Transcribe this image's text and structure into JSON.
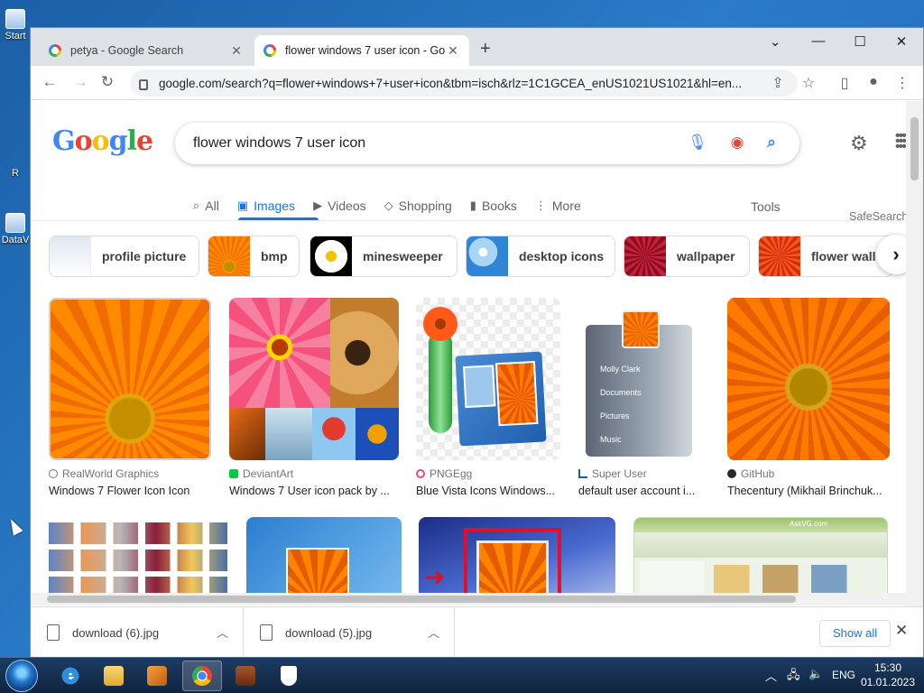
{
  "desktop": {
    "icons": [
      {
        "label": "Start"
      },
      {
        "label": "R"
      },
      {
        "label": "DataV"
      }
    ]
  },
  "browser": {
    "tabs": [
      {
        "title": "petya - Google Search",
        "active": false
      },
      {
        "title": "flower windows 7 user icon - Go",
        "active": true
      }
    ],
    "url": "google.com/search?q=flower+windows+7+user+icon&tbm=isch&rlz=1C1GCEA_enUS1021US1021&hl=en..."
  },
  "search": {
    "logo_letters": [
      "G",
      "o",
      "o",
      "g",
      "l",
      "e"
    ],
    "query": "flower windows 7 user icon",
    "nav_tabs": [
      {
        "label": "All",
        "icon": "search-icon",
        "active": false
      },
      {
        "label": "Images",
        "icon": "image-icon",
        "active": true
      },
      {
        "label": "Videos",
        "icon": "play-icon",
        "active": false
      },
      {
        "label": "Shopping",
        "icon": "tag-icon",
        "active": false
      },
      {
        "label": "Books",
        "icon": "book-icon",
        "active": false
      },
      {
        "label": "More",
        "icon": "kebab-icon",
        "active": false
      }
    ],
    "tools": "Tools",
    "safesearch": "SafeSearch"
  },
  "chips": [
    {
      "label": "profile picture"
    },
    {
      "label": "bmp"
    },
    {
      "label": "minesweeper"
    },
    {
      "label": "desktop icons"
    },
    {
      "label": "wallpaper"
    },
    {
      "label": "flower wall"
    }
  ],
  "results": [
    {
      "source": "RealWorld Graphics",
      "caption": "Windows 7 Flower Icon Icon"
    },
    {
      "source": "DeviantArt",
      "caption": "Windows 7 User icon pack by ..."
    },
    {
      "source": "PNGEgg",
      "caption": "Blue Vista Icons Windows..."
    },
    {
      "source": "Super User",
      "caption": "default user account i..."
    },
    {
      "source": "GitHub",
      "caption": "Thecentury (Mikhail Brinchuk..."
    }
  ],
  "result3_menu": [
    "Molly Clark",
    "Documents",
    "Pictures",
    "Music"
  ],
  "result4_site": "AskVG.com",
  "downloads": [
    {
      "filename": "download (6).jpg"
    },
    {
      "filename": "download (5).jpg"
    }
  ],
  "downloads_show_all": "Show all",
  "taskbar": {
    "language": "ENG",
    "time": "15:30",
    "date": "01.01.2023"
  },
  "colors": {
    "accent": "#1a73e8",
    "google_blue": "#4285f4",
    "google_red": "#ea4335",
    "google_yellow": "#fbbc05",
    "google_green": "#34a853"
  }
}
